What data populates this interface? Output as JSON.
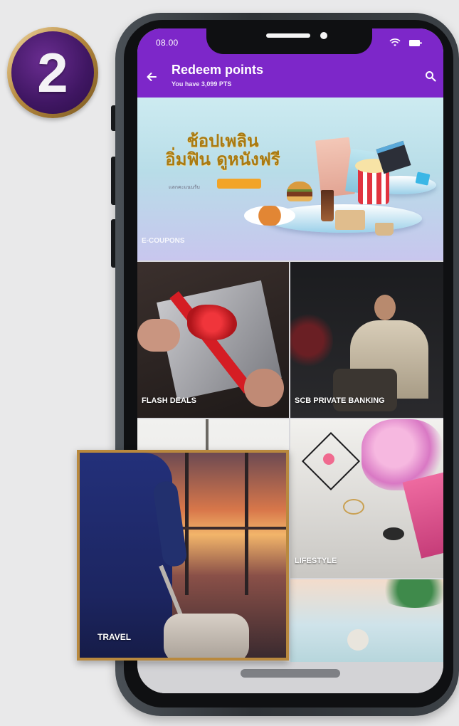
{
  "step": {
    "number": "2"
  },
  "status_bar": {
    "time": "08.00"
  },
  "app_bar": {
    "title": "Redeem points",
    "subtitle": "You have 3,099 PTS"
  },
  "banner": {
    "headline_line1": "ช้อปเพลิน",
    "headline_line2": "อิ่มฟิน ดูหนังฟรี",
    "subtext": "แลกคะแนนรับ",
    "category_label": "E-COUPONS"
  },
  "tiles": [
    {
      "label": "FLASH DEALS"
    },
    {
      "label": "SCB PRIVATE BANKING"
    },
    {
      "label": "LIFESTYLE"
    }
  ],
  "highlight": {
    "label": "TRAVEL"
  },
  "colors": {
    "brand_purple": "#7d27c9",
    "gold_frame": "#b9893e",
    "badge_purple": "#3f1662"
  },
  "icons": {
    "back": "back-arrow-icon",
    "search": "search-icon",
    "wifi": "wifi-icon",
    "battery": "battery-icon"
  }
}
